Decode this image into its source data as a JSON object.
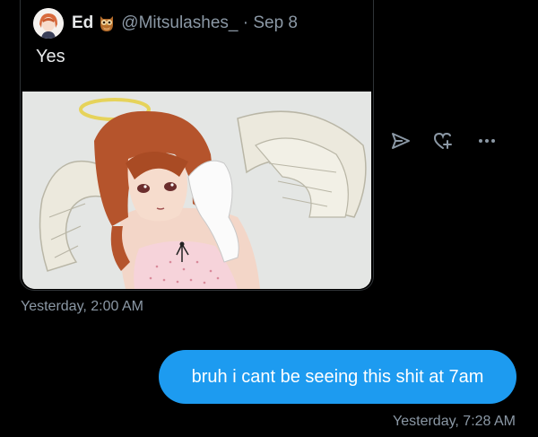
{
  "quoted_tweet": {
    "author_name": "Ed",
    "badge_icon": "owl-icon",
    "handle": "@Mitsulashes_",
    "separator": "·",
    "date": "Sep 8",
    "text": "Yes",
    "media_description_icon": "angel-anime-image"
  },
  "actions": {
    "share_icon": "share-send-icon",
    "react_icon": "add-reaction-icon",
    "more_icon": "more-dots-icon"
  },
  "received_timestamp": "Yesterday, 2:00 AM",
  "sent_message": {
    "text": "bruh i cant be seeing this shit at 7am",
    "timestamp": "Yesterday, 7:28 AM",
    "bubble_color": "#1d9bf0"
  },
  "colors": {
    "background": "#000000",
    "muted_text": "#8b98a5",
    "primary_text": "#e7e9ea"
  }
}
